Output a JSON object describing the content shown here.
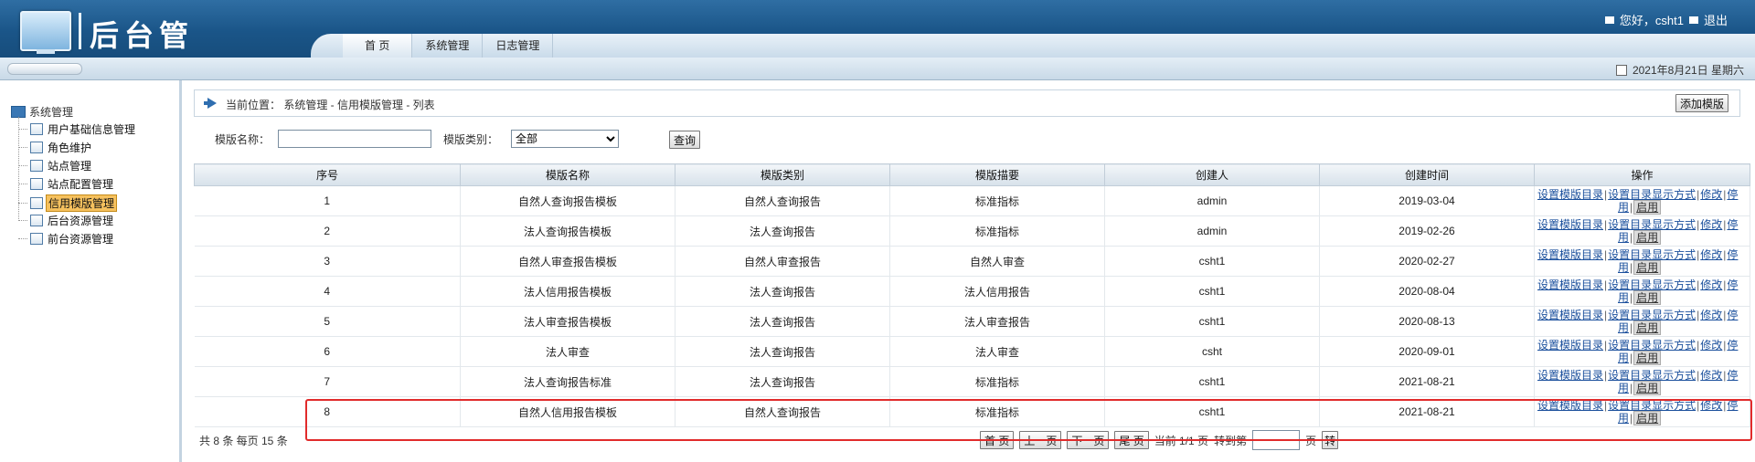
{
  "header": {
    "title": "后台管理",
    "greeting": "您好，csht1",
    "logout": "退出",
    "tabs": [
      {
        "label": "首 页"
      },
      {
        "label": "系统管理"
      },
      {
        "label": "日志管理"
      }
    ]
  },
  "subbar": {
    "date": "2021年8月21日 星期六"
  },
  "sidebar": {
    "root": "系统管理",
    "items": [
      {
        "label": "用户基础信息管理"
      },
      {
        "label": "角色维护"
      },
      {
        "label": "站点管理"
      },
      {
        "label": "站点配置管理"
      },
      {
        "label": "信用模版管理"
      },
      {
        "label": "后台资源管理"
      },
      {
        "label": "前台资源管理"
      }
    ]
  },
  "location": {
    "text": "当前位置：  系统管理 - 信用模版管理 - 列表"
  },
  "add_button": "添加模版",
  "search": {
    "name_label": "模版名称：",
    "name_value": "",
    "type_label": "模版类别：",
    "type_selected": "全部",
    "query_button": "查询"
  },
  "table": {
    "headers": [
      "序号",
      "模版名称",
      "模版类别",
      "模版描要",
      "创建人",
      "创建时间",
      "操作"
    ],
    "rows": [
      {
        "no": "1",
        "name": "自然人查询报告模板",
        "category": "自然人查询报告",
        "summary": "标准指标",
        "creator": "admin",
        "created": "2019-03-04"
      },
      {
        "no": "2",
        "name": "法人查询报告模板",
        "category": "法人查询报告",
        "summary": "标准指标",
        "creator": "admin",
        "created": "2019-02-26"
      },
      {
        "no": "3",
        "name": "自然人审查报告模板",
        "category": "自然人审查报告",
        "summary": "自然人审查",
        "creator": "csht1",
        "created": "2020-02-27"
      },
      {
        "no": "4",
        "name": "法人信用报告模板",
        "category": "法人查询报告",
        "summary": "法人信用报告",
        "creator": "csht1",
        "created": "2020-08-04"
      },
      {
        "no": "5",
        "name": "法人审查报告模板",
        "category": "法人查询报告",
        "summary": "法人审查报告",
        "creator": "csht1",
        "created": "2020-08-13"
      },
      {
        "no": "6",
        "name": "法人审查",
        "category": "法人查询报告",
        "summary": "法人审查",
        "creator": "csht",
        "created": "2020-09-01"
      },
      {
        "no": "7",
        "name": "法人查询报告标准",
        "category": "法人查询报告",
        "summary": "标准指标",
        "creator": "csht1",
        "created": "2021-08-21"
      },
      {
        "no": "8",
        "name": "自然人信用报告模板",
        "category": "自然人查询报告",
        "summary": "标准指标",
        "creator": "csht1",
        "created": "2021-08-21"
      }
    ],
    "ops": {
      "set_dir": "设置模版目录",
      "set_dir_display": "设置目录显示方式",
      "edit": "修改",
      "disable_a": "停",
      "disable_b": "用",
      "enable": "启用",
      "sep": "|"
    }
  },
  "pager": {
    "summary": "共 8 条  每页  15  条",
    "first": "首 页",
    "prev": "上一页",
    "next": "下一页",
    "last": "尾 页",
    "current": "当前 1/1 页",
    "goto": "转到第",
    "page_unit": "页",
    "go": "转"
  }
}
